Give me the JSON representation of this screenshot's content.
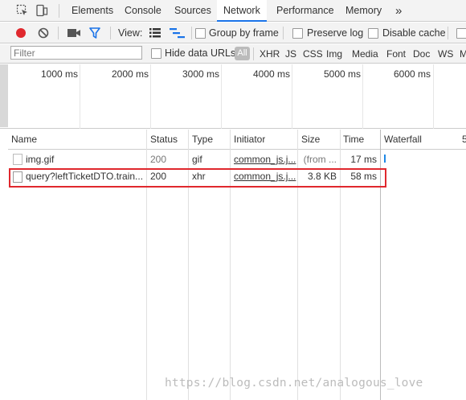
{
  "tabs": [
    "Elements",
    "Console",
    "Sources",
    "Network",
    "Performance",
    "Memory"
  ],
  "more_tabs_glyph": "»",
  "active_tab": "Network",
  "toolbar": {
    "view_label": "View:",
    "group_by_frame": "Group by frame",
    "preserve_log": "Preserve log",
    "disable_cache": "Disable cache"
  },
  "filter": {
    "placeholder": "Filter",
    "hide_data_urls": "Hide data URLs",
    "all": "All",
    "types": [
      "XHR",
      "JS",
      "CSS",
      "Img",
      "Media",
      "Font",
      "Doc",
      "WS",
      "M"
    ]
  },
  "overview_ticks": [
    "1000 ms",
    "2000 ms",
    "3000 ms",
    "4000 ms",
    "5000 ms",
    "6000 ms"
  ],
  "columns": {
    "name": "Name",
    "status": "Status",
    "type": "Type",
    "initiator": "Initiator",
    "size": "Size",
    "time": "Time",
    "waterfall": "Waterfall",
    "waterfall_tick": "5"
  },
  "rows": [
    {
      "name": "img.gif",
      "status": "200",
      "type": "gif",
      "initiator": "common_js.j...",
      "size": "(from ...",
      "time": "17 ms"
    },
    {
      "name": "query?leftTicketDTO.train...",
      "status": "200",
      "type": "xhr",
      "initiator": "common_js.j...",
      "size": "3.8 KB",
      "time": "58 ms"
    }
  ],
  "watermark": "https://blog.csdn.net/analogous_love",
  "colors": {
    "record": "#e0282e",
    "accent": "#1a73e8",
    "highlight": "#e0282e",
    "waterfall_bar": "#1e88e5"
  }
}
